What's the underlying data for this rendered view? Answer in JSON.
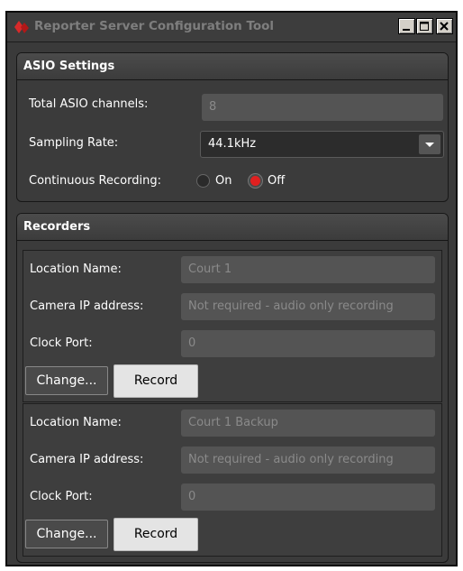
{
  "window": {
    "title": "Reporter Server Configuration Tool",
    "controls": [
      "minimize",
      "maximize",
      "close"
    ]
  },
  "asio": {
    "header": "ASIO Settings",
    "total_channels_label": "Total ASIO channels:",
    "total_channels_value": "8",
    "sampling_rate_label": "Sampling Rate:",
    "sampling_rate_value": "44.1kHz",
    "continuous_label": "Continuous Recording:",
    "on_label": "On",
    "off_label": "Off",
    "continuous_selected": "Off"
  },
  "recorders": {
    "header": "Recorders",
    "items": [
      {
        "location_label": "Location Name:",
        "location_value": "Court 1",
        "camera_label": "Camera IP address:",
        "camera_value": "Not required - audio only recording",
        "clock_label": "Clock Port:",
        "clock_value": "0",
        "change_label": "Change...",
        "record_label": "Record"
      },
      {
        "location_label": "Location Name:",
        "location_value": "Court 1 Backup",
        "camera_label": "Camera IP address:",
        "camera_value": "Not required - audio only recording",
        "clock_label": "Clock Port:",
        "clock_value": "0",
        "change_label": "Change...",
        "record_label": "Record"
      }
    ]
  },
  "colors": {
    "accent_red": "#e02020",
    "background": "#3a3a3a"
  }
}
